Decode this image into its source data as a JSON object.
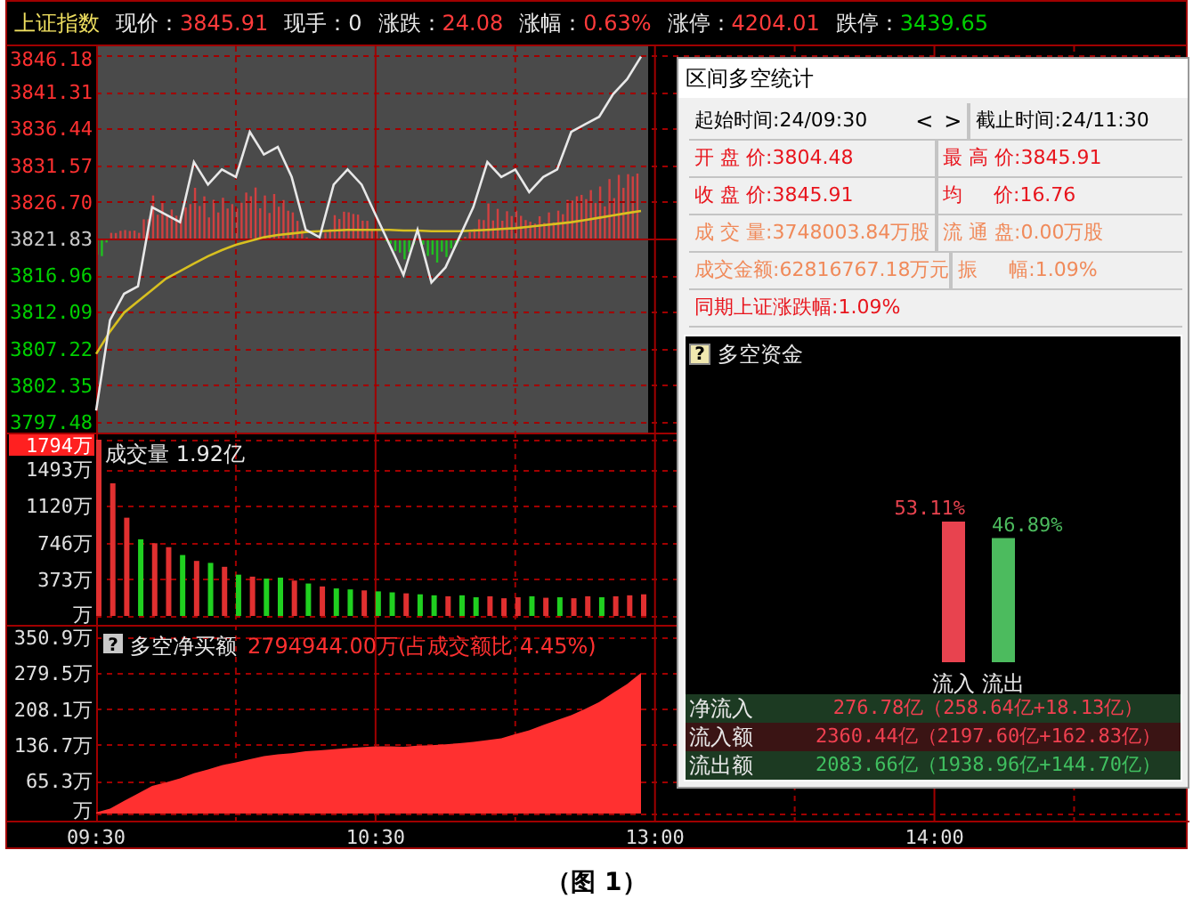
{
  "quote_bar": {
    "name": "上证指数",
    "fields": [
      {
        "label": "现价：",
        "value": "3845.91",
        "color": "#ff3b3b"
      },
      {
        "label": "现手：",
        "value": "0",
        "color": "#e8e8e8"
      },
      {
        "label": "涨跌：",
        "value": "24.08",
        "color": "#ff3b3b"
      },
      {
        "label": "涨幅：",
        "value": "0.63%",
        "color": "#ff3b3b"
      },
      {
        "label": "涨停：",
        "value": "4204.01",
        "color": "#ff3b3b"
      },
      {
        "label": "跌停：",
        "value": "3439.65",
        "color": "#00d000"
      }
    ]
  },
  "price_panel": {
    "chart_data": {
      "type": "line",
      "grid": true,
      "categories": [
        null,
        null,
        null,
        null,
        null,
        null,
        null,
        null,
        null,
        null,
        null,
        null,
        null,
        null,
        null,
        null,
        null,
        null,
        null,
        null,
        null,
        null,
        null,
        null,
        null,
        null,
        null,
        null,
        null,
        null,
        null,
        null,
        null,
        null,
        null,
        null,
        null,
        null,
        null,
        null,
        null,
        null,
        null,
        null,
        null,
        null,
        null,
        null,
        null,
        null,
        null,
        null,
        null,
        null,
        null,
        null,
        null,
        null,
        null,
        null,
        null,
        null,
        null,
        null,
        null,
        null,
        null,
        null,
        null,
        null,
        null,
        null,
        null,
        null,
        null,
        null,
        null,
        null,
        null
      ],
      "ylim": [
        3797.48,
        3846.18
      ],
      "yticks": [
        {
          "value": 3846.18,
          "label": "3846.18"
        },
        {
          "value": 3841.31,
          "label": "3841.31"
        },
        {
          "value": 3836.44,
          "label": "3836.44"
        },
        {
          "value": 3831.57,
          "label": "3831.57"
        },
        {
          "value": 3826.7,
          "label": "3826.70"
        },
        {
          "value": 3821.83,
          "label": "3821.83"
        },
        {
          "value": 3816.96,
          "label": "3816.96"
        },
        {
          "value": 3812.09,
          "label": "3812.09"
        },
        {
          "value": 3807.22,
          "label": "3807.22"
        },
        {
          "value": 3802.35,
          "label": "3802.35"
        },
        {
          "value": 3797.48,
          "label": "3797.48"
        }
      ],
      "series": [
        {
          "color": "#d8c020",
          "values": [
            3806.5,
            3809.5,
            3812.0,
            3813.5,
            3815.0,
            3816.5,
            3817.5,
            3818.5,
            3819.5,
            3820.3,
            3821.0,
            3821.5,
            3822.0,
            3822.3,
            3822.5,
            3822.7,
            3822.8,
            3822.9,
            3823.0,
            3823.0,
            3823.0,
            3823.0,
            3822.9,
            3822.9,
            3822.8,
            3822.8,
            3822.8,
            3822.9,
            3823.0,
            3823.1,
            3823.2,
            3823.4,
            3823.6,
            3823.8,
            3824.0,
            3824.3,
            3824.6,
            3824.9,
            3825.2,
            3825.5,
            null,
            null,
            null,
            null,
            null,
            null,
            null,
            null,
            null,
            null,
            null,
            null,
            null,
            null,
            null,
            null,
            null,
            null,
            null,
            null,
            null,
            null,
            null,
            null,
            null,
            null,
            null,
            null,
            null,
            null,
            null,
            null,
            null,
            null,
            null,
            null,
            null,
            null,
            null
          ]
        },
        {
          "color": "#e8e8e8",
          "values": [
            3799.0,
            3811.0,
            3814.5,
            3815.5,
            3826.0,
            3825.0,
            3824.0,
            3832.0,
            3829.0,
            3831.0,
            3830.0,
            3836.0,
            3833.0,
            3834.0,
            3830.0,
            3823.0,
            3822.0,
            3829.0,
            3831.0,
            3829.0,
            3825.0,
            3821.0,
            3817.0,
            3823.0,
            3816.0,
            3818.0,
            3822.0,
            3826.0,
            3832.0,
            3830.0,
            3831.0,
            3828.0,
            3830.0,
            3831.0,
            3836.0,
            3837.0,
            3838.0,
            3841.0,
            3843.0,
            3846.0,
            null,
            null,
            null,
            null,
            null,
            null,
            null,
            null,
            null,
            null,
            null,
            null,
            null,
            null,
            null,
            null,
            null,
            null,
            null,
            null,
            null,
            null,
            null,
            null,
            null,
            null,
            null,
            null,
            null,
            null,
            null,
            null,
            null,
            null,
            null,
            null,
            null,
            null,
            null
          ]
        }
      ]
    }
  },
  "volume_panel": {
    "chart_data": {
      "type": "bar",
      "title": "成交量 1.92亿",
      "stacked": true,
      "grid": true,
      "categories": [
        null,
        null,
        null,
        null,
        null,
        null,
        null,
        null,
        null,
        null,
        null,
        null,
        null,
        null,
        null,
        null,
        null,
        null,
        null,
        null,
        null,
        null,
        null,
        null,
        null,
        null,
        null,
        null,
        null,
        null,
        null,
        null,
        null,
        null,
        null,
        null,
        null,
        null,
        null,
        null
      ],
      "ylim": [
        0,
        1794
      ],
      "yticks": [
        {
          "value": 1794,
          "label": "1794万"
        },
        {
          "value": 1493,
          "label": "1493万"
        },
        {
          "value": 1120,
          "label": "1120万"
        },
        {
          "value": 746,
          "label": "746万"
        },
        {
          "value": 373,
          "label": "373万"
        },
        {
          "value": 0,
          "label": "万"
        }
      ],
      "series": [
        {
          "color": "#e03030",
          "values": [
            1794,
            1350,
            1000,
            null,
            740,
            700,
            null,
            560,
            null,
            500,
            null,
            400,
            null,
            null,
            360,
            null,
            300,
            null,
            null,
            260,
            null,
            null,
            230,
            null,
            null,
            200,
            null,
            null,
            200,
            180,
            190,
            null,
            185,
            null,
            180,
            200,
            null,
            200,
            210,
            220
          ]
        },
        {
          "color": "#20d020",
          "values": [
            null,
            null,
            null,
            780,
            null,
            null,
            620,
            null,
            540,
            null,
            420,
            null,
            380,
            390,
            null,
            330,
            null,
            280,
            270,
            null,
            250,
            240,
            null,
            220,
            210,
            null,
            210,
            190,
            null,
            null,
            null,
            200,
            null,
            190,
            null,
            null,
            190,
            null,
            null,
            null
          ]
        }
      ]
    }
  },
  "net_buy_panel": {
    "help_glyph": "?",
    "summary": "2794944.00万(占成交额比 4.45%)",
    "chart_data": {
      "type": "area",
      "title": "多空净买额",
      "grid": true,
      "categories": [
        "09:30",
        null,
        null,
        null,
        null,
        null,
        null,
        null,
        null,
        null,
        null,
        null,
        null,
        null,
        null,
        null,
        null,
        null,
        null,
        null,
        "10:30",
        null,
        null,
        null,
        null,
        null,
        null,
        null,
        null,
        null,
        null,
        null,
        null,
        null,
        null,
        null,
        null,
        null,
        null,
        null,
        "13:00",
        null,
        null,
        null,
        null,
        null,
        null,
        null,
        null,
        null,
        null,
        null,
        null,
        null,
        null,
        null,
        null,
        null,
        null,
        null,
        "14:00",
        null,
        null,
        null,
        null,
        null,
        null,
        null,
        null,
        null,
        null,
        null,
        null,
        null,
        null,
        null,
        null,
        null,
        null
      ],
      "ylim": [
        0,
        350.9
      ],
      "yticks": [
        {
          "value": 350.9,
          "label": "350.9万"
        },
        {
          "value": 279.5,
          "label": "279.5万"
        },
        {
          "value": 208.1,
          "label": "208.1万"
        },
        {
          "value": 136.7,
          "label": "136.7万"
        },
        {
          "value": 65.3,
          "label": "65.3万"
        },
        {
          "value": 0,
          "label": "万"
        }
      ],
      "series": [
        {
          "color": "#ff3030",
          "values": [
            2,
            10,
            25,
            40,
            55,
            62,
            70,
            80,
            88,
            96,
            102,
            108,
            114,
            118,
            120,
            124,
            126,
            128,
            130,
            132,
            134,
            134,
            133,
            135,
            136,
            138,
            140,
            143,
            146,
            150,
            158,
            166,
            176,
            186,
            196,
            208,
            222,
            240,
            258,
            280,
            null,
            null,
            null,
            null,
            null,
            null,
            null,
            null,
            null,
            null,
            null,
            null,
            null,
            null,
            null,
            null,
            null,
            null,
            null,
            null,
            null,
            null,
            null,
            null,
            null,
            null,
            null,
            null,
            null,
            null,
            null,
            null,
            null,
            null,
            null,
            null,
            null,
            null,
            null
          ]
        }
      ]
    }
  },
  "dialog": {
    "title": "区间多空统计",
    "stats": [
      {
        "cells": [
          {
            "text": "起始时间:24/09:30",
            "color": "#000000",
            "nav_buttons": [
              "<",
              ">"
            ]
          },
          {
            "text": "截止时间:24/11:30",
            "color": "#000000"
          }
        ]
      },
      {
        "cells": [
          {
            "text": "开 盘 价:3804.48",
            "color": "#e8141c"
          },
          {
            "text": "最 高 价:3845.91",
            "color": "#e8141c"
          }
        ]
      },
      {
        "cells": [
          {
            "text": "收 盘 价:3845.91",
            "color": "#e8141c"
          },
          {
            "text": "均     价:16.76",
            "color": "#e8141c"
          }
        ]
      },
      {
        "cells": [
          {
            "text": "成 交 量:3748003.84万股",
            "color": "#f08a5a"
          },
          {
            "text": "流 通 盘:0.00万股",
            "color": "#f08a5a"
          }
        ]
      },
      {
        "cells": [
          {
            "text": "成交金额:62816767.18万元",
            "color": "#f08a5a"
          },
          {
            "text": "振     幅:1.09%",
            "color": "#f08a5a"
          }
        ]
      }
    ],
    "footer_stat": {
      "text": "同期上证涨跌幅:1.09%",
      "color": "#e8141c"
    },
    "fund": {
      "help_glyph": "?",
      "title": "多空资金",
      "chart_data": {
        "type": "bar",
        "categories": [
          "流入",
          "流出"
        ],
        "series": [
          {
            "color": "#e8434f",
            "values": [
              53.11,
              null
            ],
            "value_labels": [
              "53.11%",
              null
            ]
          },
          {
            "color": "#4cbb5e",
            "values": [
              null,
              46.89
            ],
            "value_labels": [
              null,
              "46.89%"
            ]
          }
        ]
      },
      "rows": [
        {
          "kind": "net",
          "label": "净流入",
          "value": "276.78亿（258.64亿+18.13亿）"
        },
        {
          "kind": "inflow",
          "label": "流入额",
          "value": "2360.44亿（2197.60亿+162.83亿）"
        },
        {
          "kind": "outflow",
          "label": "流出额",
          "value": "2083.66亿（1938.96亿+144.70亿）"
        }
      ]
    }
  },
  "caption": "（图 1）"
}
